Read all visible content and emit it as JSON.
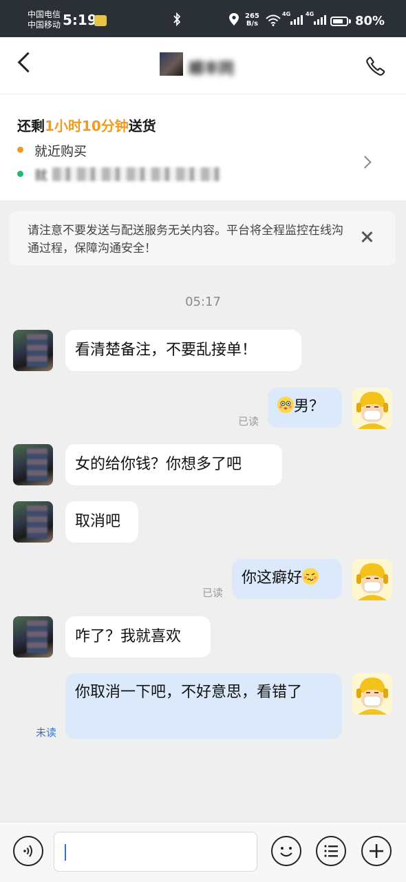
{
  "status_bar": {
    "carrier1": "中国电信",
    "carrier2": "中国移动",
    "time": "5:19",
    "net_speed_value": "265",
    "net_speed_unit": "B/s",
    "net1": "4G",
    "net2": "4G",
    "battery": "80%",
    "battery_level": 0.8
  },
  "header": {
    "contact_name": "顺丰同"
  },
  "delivery": {
    "title_prefix": "还剩",
    "title_highlight": "1小时10分钟",
    "title_suffix": "送货",
    "line1": "就近购买",
    "address_visible": "就"
  },
  "notice": {
    "text": "请注意不要发送与配送服务无关内容。平台将全程监控在线沟通过程，保障沟通安全！"
  },
  "chat": {
    "timestamp": "05:17",
    "messages": [
      {
        "side": "in",
        "text": "看清楚备注，不要乱接单！"
      },
      {
        "side": "out",
        "text": "男？",
        "emoji": "flushed-face",
        "status": "已读"
      },
      {
        "side": "in",
        "text": "女的给你钱？你想多了吧"
      },
      {
        "side": "in",
        "text": "取消吧"
      },
      {
        "side": "out",
        "text": "你这癖好",
        "emoji": "woozy-face",
        "status": "已读"
      },
      {
        "side": "in",
        "text": "咋了？我就喜欢"
      },
      {
        "side": "out",
        "text": "你取消一下吧，不好意思，看错了",
        "status": "未读"
      }
    ]
  },
  "colors": {
    "accent_orange": "#f39a1c",
    "dot_green": "#1fbf6a",
    "outgoing_bubble": "#dbe9fb",
    "unread_blue": "#3b73c9"
  }
}
